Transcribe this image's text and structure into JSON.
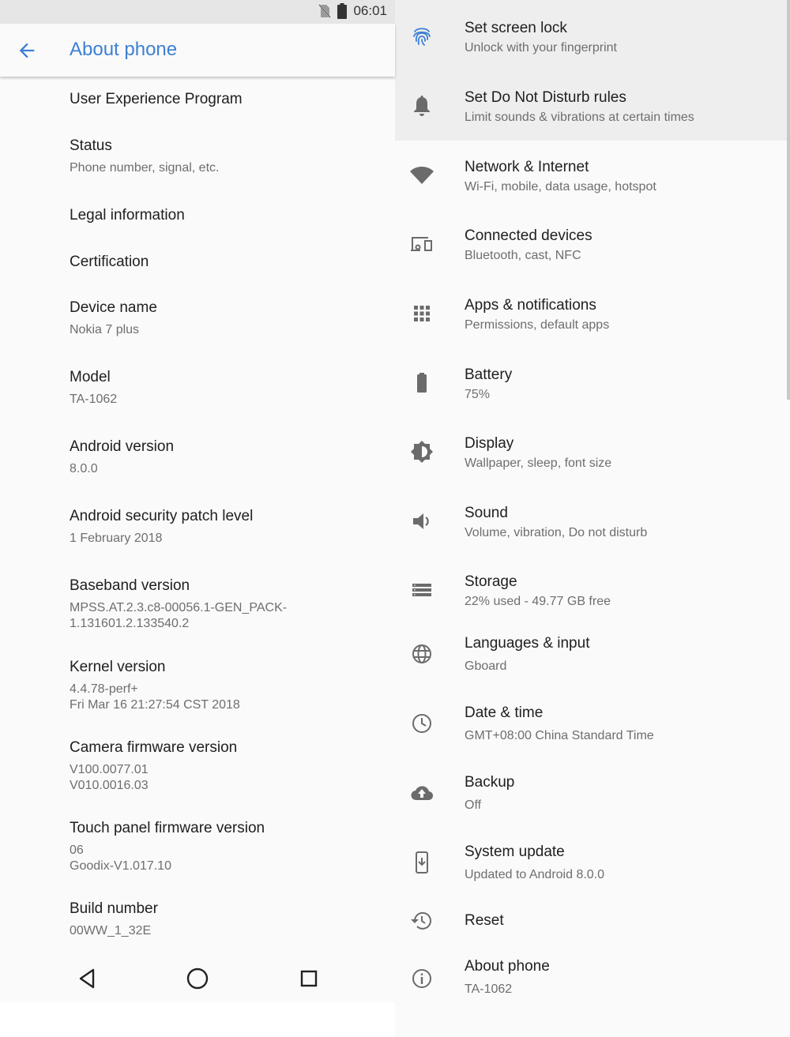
{
  "status_bar": {
    "time": "06:01",
    "icons": [
      "no-sim-icon",
      "battery-icon"
    ]
  },
  "left_panel": {
    "title": "About phone",
    "items": [
      {
        "title": "User Experience Program",
        "subtitle": ""
      },
      {
        "title": "Status",
        "subtitle": "Phone number, signal, etc."
      },
      {
        "title": "Legal information",
        "subtitle": ""
      },
      {
        "title": "Certification",
        "subtitle": ""
      },
      {
        "title": "Device name",
        "subtitle": "Nokia 7 plus"
      },
      {
        "title": "Model",
        "subtitle": "TA-1062"
      },
      {
        "title": "Android version",
        "subtitle": "8.0.0"
      },
      {
        "title": "Android security patch level",
        "subtitle": "1 February 2018"
      },
      {
        "title": "Baseband version",
        "subtitle": "MPSS.AT.2.3.c8-00056.1-GEN_PACK-\n1.131601.2.133540.2"
      },
      {
        "title": "Kernel version",
        "subtitle": "4.4.78-perf+\nFri Mar 16 21:27:54 CST 2018"
      },
      {
        "title": "Camera firmware version",
        "subtitle": "V100.0077.01\nV010.0016.03"
      },
      {
        "title": "Touch panel firmware version",
        "subtitle": "06\nGoodix-V1.017.10"
      },
      {
        "title": "Build number",
        "subtitle": "00WW_1_32E"
      }
    ]
  },
  "right_panel": {
    "suggestions": [
      {
        "icon": "fingerprint-icon",
        "title": "Set screen lock",
        "subtitle": "Unlock with your fingerprint"
      },
      {
        "icon": "bell-icon",
        "title": "Set Do Not Disturb rules",
        "subtitle": "Limit sounds & vibrations at certain times"
      }
    ],
    "items": [
      {
        "icon": "wifi-icon",
        "title": "Network & Internet",
        "subtitle": "Wi-Fi, mobile, data usage, hotspot"
      },
      {
        "icon": "devices-icon",
        "title": "Connected devices",
        "subtitle": "Bluetooth, cast, NFC"
      },
      {
        "icon": "apps-grid-icon",
        "title": "Apps & notifications",
        "subtitle": "Permissions, default apps"
      },
      {
        "icon": "battery-icon",
        "title": "Battery",
        "subtitle": "75%"
      },
      {
        "icon": "brightness-icon",
        "title": "Display",
        "subtitle": "Wallpaper, sleep, font size"
      },
      {
        "icon": "volume-icon",
        "title": "Sound",
        "subtitle": "Volume, vibration, Do not disturb"
      },
      {
        "icon": "storage-icon",
        "title": "Storage",
        "subtitle": "22% used - 49.77 GB free"
      },
      {
        "icon": "globe-icon",
        "title": "Languages & input",
        "subtitle": "Gboard"
      },
      {
        "icon": "clock-icon",
        "title": "Date & time",
        "subtitle": "GMT+08:00 China Standard Time"
      },
      {
        "icon": "cloud-upload-icon",
        "title": "Backup",
        "subtitle": "Off"
      },
      {
        "icon": "system-update-icon",
        "title": "System update",
        "subtitle": "Updated to Android 8.0.0"
      },
      {
        "icon": "history-icon",
        "title": "Reset",
        "subtitle": ""
      },
      {
        "icon": "info-icon",
        "title": "About phone",
        "subtitle": "TA-1062"
      }
    ]
  },
  "colors": {
    "accent": "#3d7fd4",
    "icon_gray": "#6b6b6b",
    "suggestion_icon": "#3d7fd4"
  }
}
